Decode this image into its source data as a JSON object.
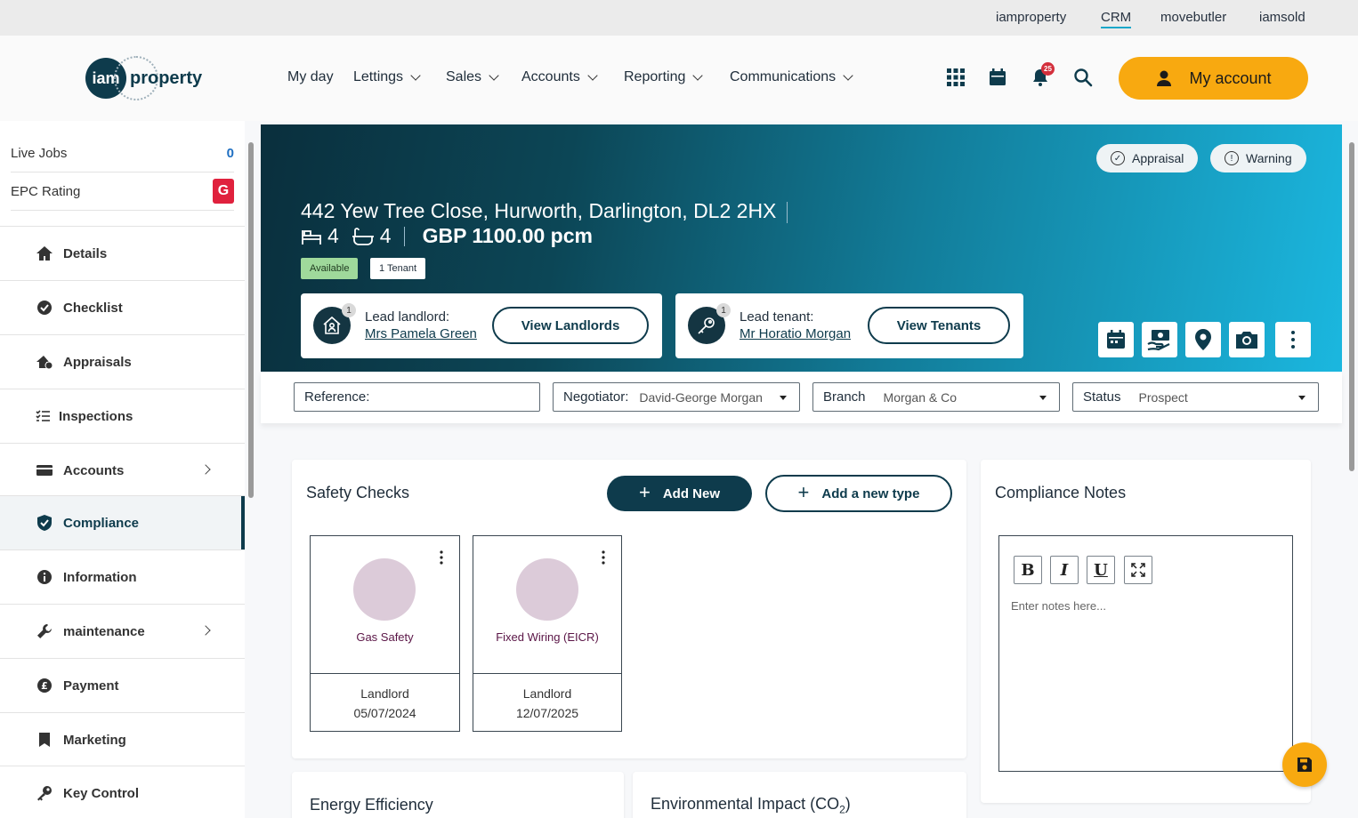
{
  "top_links": [
    "iamproperty",
    "CRM",
    "movebutler",
    "iamsold"
  ],
  "logo": {
    "mark": "iam",
    "word": "property"
  },
  "nav": [
    "My day",
    "Lettings",
    "Sales",
    "Accounts",
    "Reporting",
    "Communications"
  ],
  "notifications_count": "25",
  "my_account": "My account",
  "sidebar": {
    "live_jobs_label": "Live Jobs",
    "live_jobs_count": "0",
    "epc_label": "EPC Rating",
    "epc_value": "G",
    "items": [
      {
        "label": "Details",
        "icon": "home-icon"
      },
      {
        "label": "Checklist",
        "icon": "check-circle-icon"
      },
      {
        "label": "Appraisals",
        "icon": "house-value-icon"
      },
      {
        "label": "Inspections",
        "icon": "checklist-icon"
      },
      {
        "label": "Accounts",
        "icon": "card-icon"
      },
      {
        "label": "Compliance",
        "icon": "shield-icon"
      },
      {
        "label": "Information",
        "icon": "info-icon"
      },
      {
        "label": "maintenance",
        "icon": "wrench-icon"
      },
      {
        "label": "Payment",
        "icon": "pound-icon"
      },
      {
        "label": "Marketing",
        "icon": "bookmark-icon"
      },
      {
        "label": "Key Control",
        "icon": "key-icon"
      }
    ]
  },
  "hero": {
    "address": "442 Yew Tree Close, Hurworth, Darlington, DL2 2HX",
    "beds": "4",
    "baths": "4",
    "rent": "GBP 1100.00 pcm",
    "status_tag": "Available",
    "tenant_tag": "1 Tenant",
    "pill_appraisal": "Appraisal",
    "pill_warning": "Warning",
    "landlord_label": "Lead landlord:",
    "landlord_name": "Mrs Pamela Green",
    "landlord_count": "1",
    "view_landlords": "View Landlords",
    "tenant_label": "Lead tenant:",
    "tenant_name": "Mr Horatio Morgan",
    "tenant_count": "1",
    "view_tenants": "View Tenants"
  },
  "filters": {
    "reference_label": "Reference:",
    "negotiator_label": "Negotiator:",
    "negotiator_value": "David-George Morgan",
    "branch_label": "Branch",
    "branch_value": "Morgan & Co",
    "status_label": "Status",
    "status_value": "Prospect"
  },
  "safety": {
    "title": "Safety Checks",
    "add_new": "Add New",
    "add_type": "Add a new type",
    "cards": [
      {
        "name": "Gas Safety",
        "who": "Landlord",
        "date": "05/07/2024"
      },
      {
        "name": "Fixed Wiring (EICR)",
        "who": "Landlord",
        "date": "12/07/2025"
      }
    ]
  },
  "notes": {
    "title": "Compliance Notes",
    "bold": "B",
    "italic": "I",
    "underline": "U",
    "placeholder": "Enter notes here..."
  },
  "energy_title": "Energy Efficiency",
  "env_title": "Environmental Impact (CO",
  "env_sub": "2",
  "env_close": ")"
}
